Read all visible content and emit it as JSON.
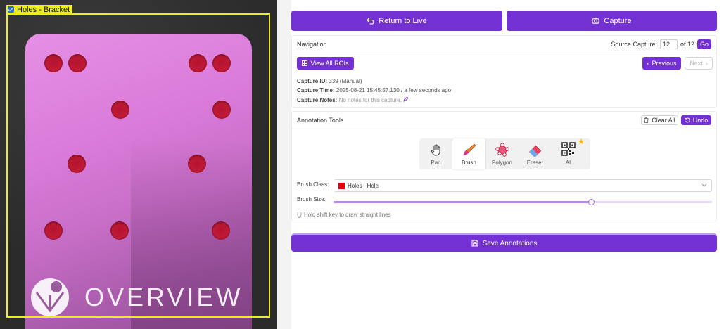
{
  "viewer": {
    "roi_label": "Holes - Bracket",
    "roi_checked": true,
    "watermark_text": "OVERVIEW"
  },
  "top_buttons": {
    "return_label": "Return to Live",
    "capture_label": "Capture"
  },
  "navigation": {
    "title": "Navigation",
    "source_capture_label": "Source Capture:",
    "source_capture_value": "12",
    "of_total": "of 12",
    "go_label": "Go",
    "view_all_label": "View All ROIs",
    "previous_label": "Previous",
    "next_label": "Next",
    "capture_id_label": "Capture ID:",
    "capture_id_value": "339 (Manual)",
    "capture_time_label": "Capture Time:",
    "capture_time_value": "2025-08-21 15:45:57.130 / a few seconds ago",
    "capture_notes_label": "Capture Notes:",
    "capture_notes_value": "No notes for this capture."
  },
  "annotation": {
    "title": "Annotation Tools",
    "clear_all_label": "Clear All",
    "undo_label": "Undo",
    "tools": [
      {
        "label": "Pan",
        "icon": "hand-icon"
      },
      {
        "label": "Brush",
        "icon": "brush-icon"
      },
      {
        "label": "Polygon",
        "icon": "polygon-icon"
      },
      {
        "label": "Eraser",
        "icon": "eraser-icon"
      },
      {
        "label": "AI",
        "icon": "qr-ai-icon"
      }
    ],
    "active_tool": "Brush",
    "brush_class_label": "Brush Class:",
    "brush_class_value": "Holes - Hole",
    "brush_class_color": "#e00000",
    "brush_size_label": "Brush Size:",
    "brush_size_fraction": 0.68,
    "hint": "Hold shift key to draw straight lines",
    "save_label": "Save Annotations"
  },
  "colors": {
    "accent": "#7330d3",
    "roi": "#ecec21",
    "hole": "#c01a36"
  }
}
